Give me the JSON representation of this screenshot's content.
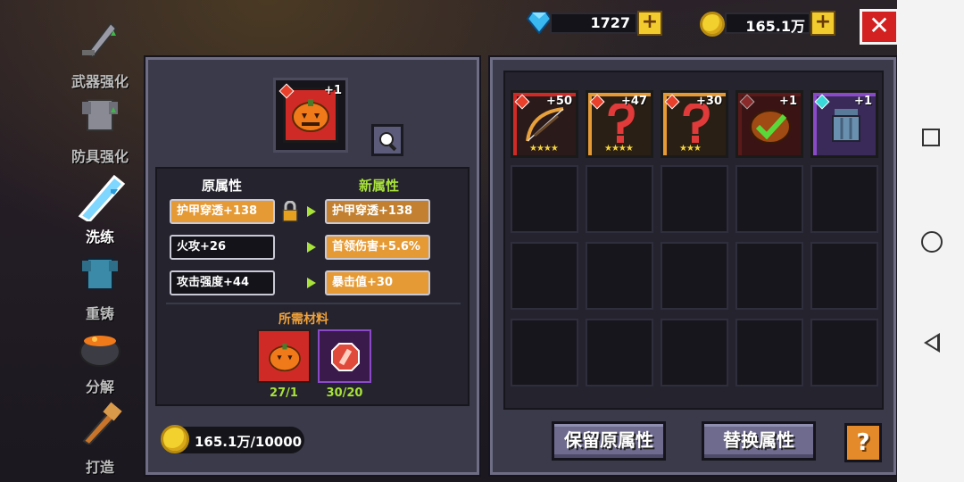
{
  "currency": {
    "gems": "1727",
    "gold": "165.1万"
  },
  "menu": {
    "items": [
      {
        "label": "武器强化"
      },
      {
        "label": "防具强化"
      },
      {
        "label": "洗练"
      },
      {
        "label": "重铸"
      },
      {
        "label": "分解"
      },
      {
        "label": "打造"
      }
    ]
  },
  "reforge": {
    "item_level": "+1",
    "old_header": "原属性",
    "new_header": "新属性",
    "rows": [
      {
        "old": "护甲穿透+138",
        "new": "护甲穿透+138",
        "locked": true
      },
      {
        "old": "火攻+26",
        "new": "首领伤害+5.6%",
        "locked": false
      },
      {
        "old": "攻击强度+44",
        "new": "暴击值+30",
        "locked": false
      }
    ],
    "materials_title": "所需材料",
    "materials": [
      {
        "count": "27/1",
        "icon": "pumpkin-icon"
      },
      {
        "count": "30/20",
        "icon": "reforge-stone-icon"
      }
    ],
    "gold_cost": "165.1万/10000"
  },
  "inventory": {
    "items": [
      {
        "level": "+50",
        "stars": "★★★★",
        "icon": "bow-icon",
        "gem": "red"
      },
      {
        "level": "+47",
        "stars": "★★★★",
        "icon": "red-whip-icon",
        "gem": "red"
      },
      {
        "level": "+30",
        "stars": "★★★",
        "icon": "red-whip-icon",
        "gem": "red"
      },
      {
        "level": "+1",
        "stars": "",
        "icon": "pumpkin-check-icon",
        "gem": "red"
      },
      {
        "level": "+1",
        "stars": "",
        "icon": "blue-armor-icon",
        "gem": "cyan"
      }
    ]
  },
  "actions": {
    "keep": "保留原属性",
    "replace": "替换属性",
    "help": "?"
  },
  "colors": {
    "accent_orange": "#e59a35",
    "new_attr_green": "#a8e23a",
    "close_red": "#d32020",
    "panel": "#3a3a4a"
  }
}
